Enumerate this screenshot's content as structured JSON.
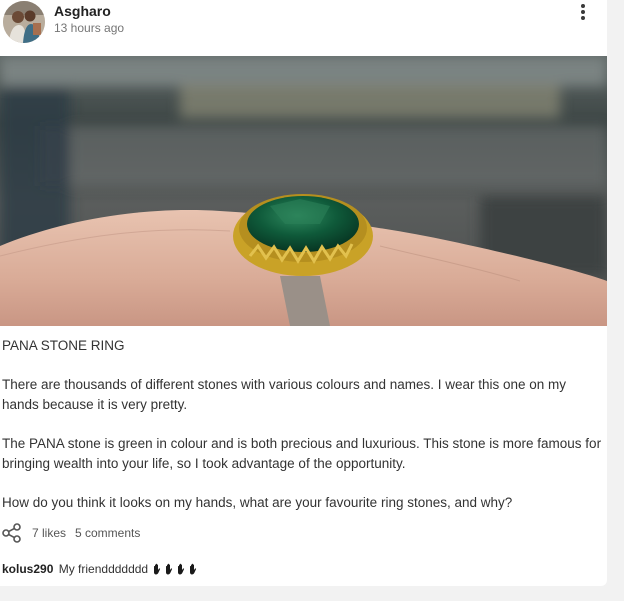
{
  "post": {
    "author": "Asgharo",
    "timestamp": "13 hours ago",
    "menu_icon": "more-vertical-icon",
    "image_subject": "green stone ring on hand",
    "title": "PANA STONE RING",
    "paragraphs": [
      "There are thousands of different stones with various colours and names. I wear this one on my hands because it is very pretty.",
      "The PANA stone is green in colour and is both precious and luxurious. This stone is more famous for bringing wealth into your life, so I took advantage of the opportunity.",
      "How do you think it looks on my hands, what are your favourite ring stones, and why?"
    ],
    "likes": "7 likes",
    "comments": "5 comments"
  },
  "comment": {
    "user": "kolus290",
    "text": "My frienddddddd",
    "emoji_icon": "raised-hand-icon",
    "emoji_count": 4
  },
  "colors": {
    "page_bg": "#f2f2f2",
    "card_bg": "#ffffff",
    "stone_green": "#0f5a3a",
    "gold": "#c9a227"
  }
}
